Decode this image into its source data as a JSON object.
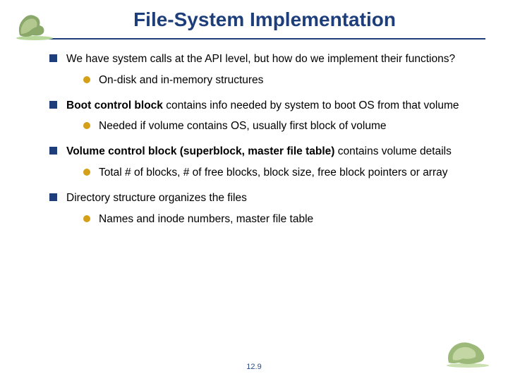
{
  "title": "File-System Implementation",
  "bullets": {
    "b1a": "We have system calls at the API level, but how do we implement their functions?",
    "b1a_s1": "On-disk and in-memory structures",
    "b1b_pre": "Boot control block ",
    "b1b_post": "contains info needed by system to boot OS from that volume",
    "b1b_s1": "Needed if volume contains OS, usually first block of volume",
    "b1c_pre": "Volume control block (superblock, master file table) ",
    "b1c_post": "contains volume details",
    "b1c_s1": "Total # of blocks, # of free blocks, block size, free block pointers or array",
    "b1d": "Directory structure organizes the files",
    "b1d_s1": "Names and inode numbers, master file table"
  },
  "footer": "12.9"
}
